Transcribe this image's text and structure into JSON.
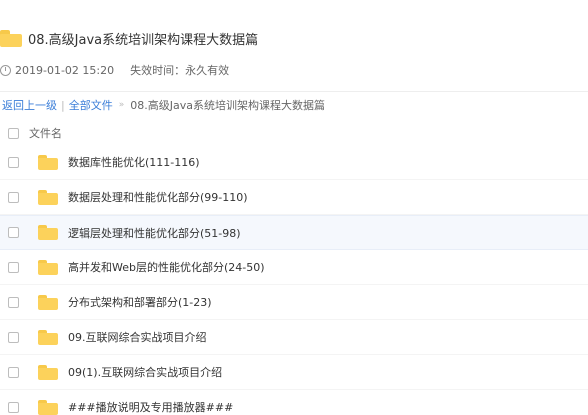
{
  "share": {
    "title": "08.高级Java系统培训架构课程大数据篇",
    "created": "2019-01-02 15:20",
    "expiry": "失效时间：永久有效"
  },
  "breadcrumb": {
    "back": "返回上一级",
    "separator": "|",
    "all_files": "全部文件",
    "arrow": "»",
    "current": "08.高级Java系统培训架构课程大数据篇"
  },
  "list": {
    "header": "文件名",
    "items": [
      {
        "name": "数据库性能优化(111-116)"
      },
      {
        "name": "数据层处理和性能优化部分(99-110)"
      },
      {
        "name": "逻辑层处理和性能优化部分(51-98)"
      },
      {
        "name": "高并发和Web层的性能优化部分(24-50)"
      },
      {
        "name": "分布式架构和部署部分(1-23)"
      },
      {
        "name": "09.互联网综合实战项目介绍"
      },
      {
        "name": "09(1).互联网综合实战项目介绍"
      },
      {
        "name": "###播放说明及专用播放器###"
      }
    ]
  },
  "icons": {
    "folder": "folder-icon",
    "clock": "clock-icon"
  },
  "colors": {
    "folder": "#fcd25b",
    "link": "#3b7ed8",
    "hover_row": "#f5f8fd"
  }
}
